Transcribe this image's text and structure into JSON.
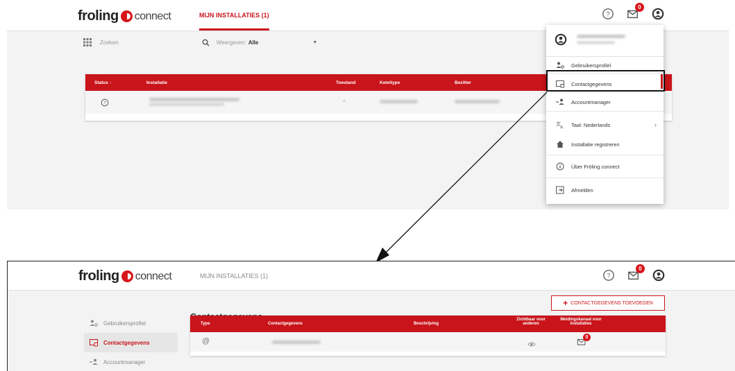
{
  "brand": {
    "name_bold": "froling",
    "name_light": "connect",
    "accent": "#c8141a"
  },
  "nav": {
    "installations_tab": "MIJN INSTALLATIES (1)",
    "mail_badge": "0"
  },
  "icons": {
    "help": "help-circle-icon",
    "mail": "mail-icon",
    "account": "account-circle-icon",
    "grid": "grid-icon",
    "search": "search-icon"
  },
  "toolbar": {
    "search_placeholder": "Zoeken",
    "view_label": "Weergeven:",
    "view_value": "Alle"
  },
  "installations_table": {
    "columns": [
      "Status ↑",
      "Installatie",
      "Toestand",
      "Keteltype",
      "Bezitter"
    ],
    "row_status_icon": "help-circle-icon",
    "row_state_symbol": "^"
  },
  "account_menu": {
    "items": [
      {
        "label": "Gebruikersprofiel",
        "icon": "user-settings-icon"
      },
      {
        "label": "Contactgegevens",
        "icon": "contact-card-icon"
      },
      {
        "label": "Accountmanager",
        "icon": "account-manager-icon"
      },
      {
        "label": "Taal: Nederlands",
        "icon": "translate-icon"
      },
      {
        "label": "Installatie registreren",
        "icon": "home-icon"
      },
      {
        "label": "Über Fröling connect",
        "icon": "info-icon"
      },
      {
        "label": "Afmelden",
        "icon": "logout-icon"
      }
    ]
  },
  "settings": {
    "sidebar": [
      {
        "label": "Gebruikersprofiel",
        "icon": "user-settings-icon"
      },
      {
        "label": "Contactgegevens",
        "icon": "contact-card-icon"
      },
      {
        "label": "Accountmanager",
        "icon": "account-manager-icon"
      }
    ],
    "title": "Contactgegevens",
    "add_button": "CONTACTGEGEVENS TOEVOEGEN",
    "columns": [
      "Type",
      "Contactgegevens",
      "Beschrijving",
      "Zichtbaar voor anderen",
      "Meldingskanaal voor installaties"
    ],
    "row_type_symbol": "@",
    "row_channel_badge": "0"
  }
}
